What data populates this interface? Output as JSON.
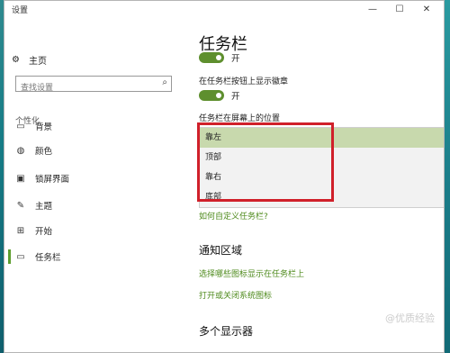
{
  "window": {
    "title": "设置",
    "controls": {
      "minimize": "—",
      "maximize": "☐",
      "close": "✕"
    }
  },
  "sidebar": {
    "home_icon": "gear-icon",
    "home_label": "主页",
    "search_placeholder": "查找设置",
    "search_icon": "search-icon",
    "section_label": "个性化",
    "items": [
      {
        "label": "背景",
        "icon": "image-icon",
        "active": false
      },
      {
        "label": "颜色",
        "icon": "palette-icon",
        "active": false
      },
      {
        "label": "锁屏界面",
        "icon": "lock-screen-icon",
        "active": false
      },
      {
        "label": "主题",
        "icon": "theme-icon",
        "active": false
      },
      {
        "label": "开始",
        "icon": "start-icon",
        "active": false
      },
      {
        "label": "任务栏",
        "icon": "taskbar-icon",
        "active": true
      }
    ]
  },
  "main": {
    "title": "任务栏",
    "toggle1_state": "开",
    "badges_label": "在任务栏按钮上显示徽章",
    "toggle2_state": "开",
    "position_label": "任务栏在屏幕上的位置",
    "position_options": [
      "靠左",
      "顶部",
      "靠右",
      "底部"
    ],
    "position_selected": "靠左",
    "customize_link": "如何自定义任务栏?",
    "notification_title": "通知区域",
    "select_icons_link": "选择哪些图标显示在任务栏上",
    "system_icons_link": "打开或关闭系统图标",
    "multi_display_title": "多个显示器"
  },
  "colors": {
    "accent": "#5e8f2e",
    "link": "#4e8a1c",
    "selected_option": "#c8d9ad",
    "highlight_box": "#d0202a"
  },
  "watermark": "@优质经验"
}
